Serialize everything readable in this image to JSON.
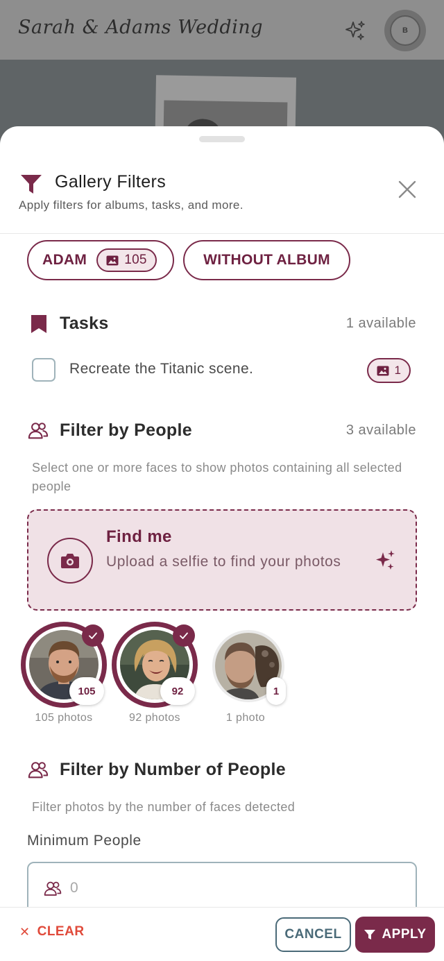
{
  "app": {
    "title": "Sarah & Adams Wedding",
    "avatar_initial": "B"
  },
  "sheet": {
    "title": "Gallery Filters",
    "subtitle": "Apply filters for albums, tasks, and more."
  },
  "albums": [
    {
      "label": "ADAM",
      "count": "105"
    },
    {
      "label": "WITHOUT ALBUM"
    }
  ],
  "tasks": {
    "title": "Tasks",
    "available": "1 available",
    "items": [
      {
        "label": "Recreate the Titanic scene.",
        "count": "1",
        "checked": false
      }
    ]
  },
  "people": {
    "title": "Filter by People",
    "available": "3 available",
    "help": "Select one or more faces to show photos containing all selected people",
    "find_me": {
      "title": "Find me",
      "subtitle": "Upload a selfie to find your photos"
    },
    "faces": [
      {
        "count": "105",
        "label": "105 photos",
        "selected": true
      },
      {
        "count": "92",
        "label": "92 photos",
        "selected": true
      },
      {
        "count": "1",
        "label": "1 photo",
        "selected": false
      }
    ]
  },
  "number_of_people": {
    "title": "Filter by Number of People",
    "help": "Filter photos by the number of faces detected",
    "min_label": "Minimum People",
    "min_placeholder": "0"
  },
  "footer": {
    "clear": "CLEAR",
    "cancel": "CANCEL",
    "apply": "APPLY"
  },
  "colors": {
    "accent": "#7a2a4a",
    "accent_light": "#f0e1e6",
    "clear": "#e04a3a",
    "cancel": "#4a6a78"
  }
}
